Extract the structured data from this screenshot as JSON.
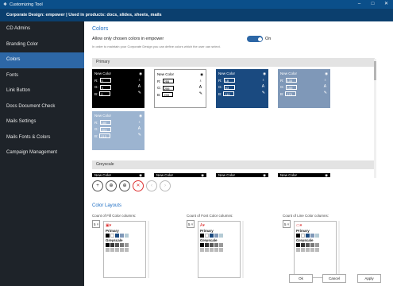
{
  "titlebar": {
    "title": "Customizing Tool",
    "controls": [
      "–",
      "□",
      "✕"
    ]
  },
  "subbar": {
    "text": "Corporate Design: empower | Used in products: docs, slides, sheets, mails"
  },
  "sidebar": {
    "items": [
      "CD Admins",
      "Branding Color",
      "Colors",
      "Fonts",
      "Link Button",
      "Docs Document Check",
      "Mails Settings",
      "Mails Fonts & Colors",
      "Campaign Management"
    ],
    "active_index": 2
  },
  "main": {
    "heading": "Colors",
    "allow_label": "Allow only chosen colors in empower",
    "hint": "In order to maintain your Corporate Design you can define colors which the user can select.",
    "toggle": {
      "state": "On",
      "on": true
    },
    "primary_title": "Primary",
    "greyscale_title": "Greyscale"
  },
  "colors": [
    {
      "title": "New Color",
      "r": "0",
      "g": "0",
      "b": "0",
      "style": "black"
    },
    {
      "title": "New Color",
      "r": "255",
      "g": "255",
      "b": "255",
      "style": "white"
    },
    {
      "title": "New Color",
      "r": "18",
      "g": "63",
      "b": "110",
      "style": "navy"
    },
    {
      "title": "New Color",
      "r": "133",
      "g": "155",
      "b": "179",
      "style": "steel"
    },
    {
      "title": "New Color",
      "r": "180",
      "g": "203",
      "b": "213",
      "style": "lblue"
    }
  ],
  "greyscale_colors": [
    "New Color",
    "New Color",
    "New Color",
    "New Color"
  ],
  "tools": [
    {
      "icon": "add-color-icon",
      "sym": "+",
      "kind": ""
    },
    {
      "icon": "add-row-icon",
      "sym": "⊕",
      "kind": ""
    },
    {
      "icon": "edit-color-icon",
      "sym": "⊕",
      "kind": ""
    },
    {
      "icon": "delete-icon",
      "sym": "✕",
      "kind": "red"
    },
    {
      "icon": "move-left-icon",
      "sym": "‹",
      "kind": "dis"
    },
    {
      "icon": "move-right-icon",
      "sym": "›",
      "kind": "dis"
    }
  ],
  "layouts": {
    "heading": "Color Layouts",
    "columns": [
      {
        "label": "Count of Fill Color columns:",
        "value": "5"
      },
      {
        "label": "Count of Font Color columns:",
        "value": "5"
      },
      {
        "label": "Count of Line Color columns:",
        "value": "5"
      }
    ],
    "palette_primary": "Primary",
    "palette_greyscale": "Greyscale",
    "primary_swatches": [
      "#000000",
      "#ffffff",
      "#1a4a80",
      "#7f98b8",
      "#b4cbd5"
    ],
    "grey_swatches": [
      "#000000",
      "#333333",
      "#555555",
      "#777777",
      "#999999"
    ]
  },
  "buttons": {
    "ok": "Ok",
    "cancel": "Cancel",
    "apply": "Apply"
  }
}
